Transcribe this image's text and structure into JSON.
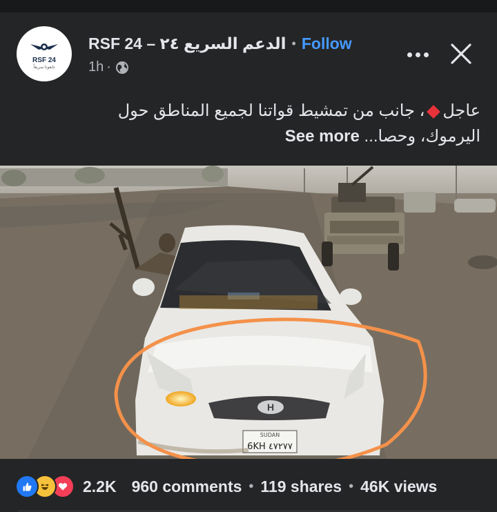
{
  "page": {
    "name": "RSF 24 – الدعم السريع ٢٤",
    "follow_label": "Follow",
    "time": "1h",
    "avatar_text": "RSF 24",
    "avatar_subtext": "تابعونا سريعاً"
  },
  "post": {
    "caption_prefix": "عاجل",
    "caption_body": "، جانب من تمشيط قواتنا لجميع المناطق حول اليرموك، وحصا...",
    "see_more_label": "See more",
    "image": {
      "alt": "",
      "plate_line1": "SUDAN",
      "plate_line2": "6KH ٤٧٢٧٧"
    }
  },
  "engagement": {
    "reaction_icons": [
      "like-icon",
      "haha-icon",
      "love-icon"
    ],
    "reaction_count": "2.2K",
    "comments": "960 comments",
    "shares": "119 shares",
    "views": "46K views"
  },
  "colors": {
    "background": "#242526",
    "follow": "#4599ff",
    "highlight_ring": "#f4914a",
    "diamond": "#e8323a"
  }
}
